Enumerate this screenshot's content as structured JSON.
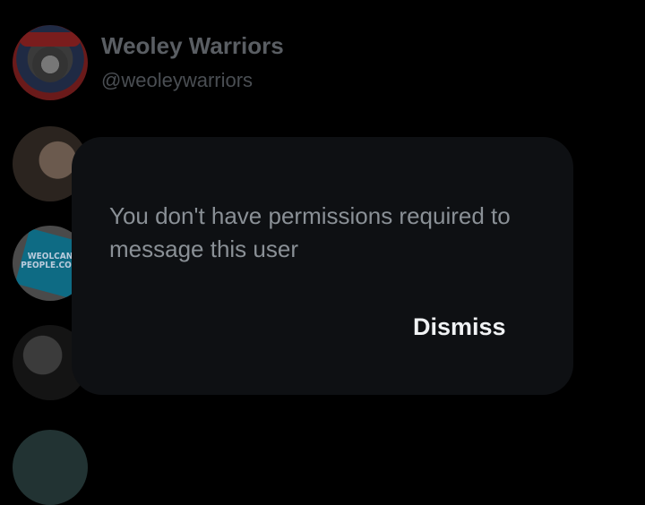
{
  "user": {
    "display_name": "Weoley Warriors",
    "handle": "@weoleywarriors"
  },
  "avatars": [
    {
      "name": "avatar-weoley-warriors"
    },
    {
      "name": "avatar-user-2"
    },
    {
      "name": "avatar-weolcan-people",
      "text": "WEOLCAN\nPEOPLE.COM"
    },
    {
      "name": "avatar-user-4"
    },
    {
      "name": "avatar-user-5"
    }
  ],
  "dialog": {
    "message": "You don't have permissions required to message this user",
    "dismiss_label": "Dismiss"
  }
}
